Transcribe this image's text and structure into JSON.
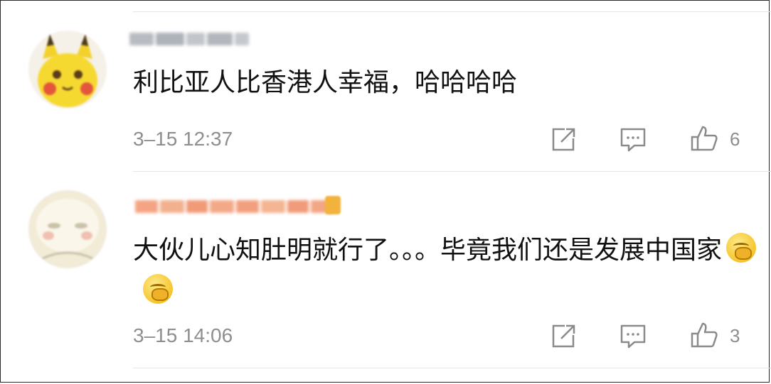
{
  "comments": [
    {
      "text": "利比亚人比香港人幸福，哈哈哈哈",
      "time": "3–15 12:37",
      "likes": "6",
      "avatar": "pikachu-avatar",
      "username_blurred": true,
      "emojis": []
    },
    {
      "text": "大伙儿心知肚明就行了。。。毕竟我们还是发展中国家",
      "time": "3–15 14:06",
      "likes": "3",
      "avatar": "cartoon-face-avatar",
      "username_blurred": true,
      "emojis": [
        "giggle-emoji",
        "giggle-emoji"
      ]
    }
  ],
  "icons": {
    "share": "share-icon",
    "comment": "comment-icon",
    "like": "thumbs-up-icon"
  },
  "colors": {
    "text": "#111111",
    "meta": "#8e8e8e",
    "divider": "#e6e6e6",
    "username_orange": "#f08a5a",
    "badge": "#f3b23c"
  }
}
